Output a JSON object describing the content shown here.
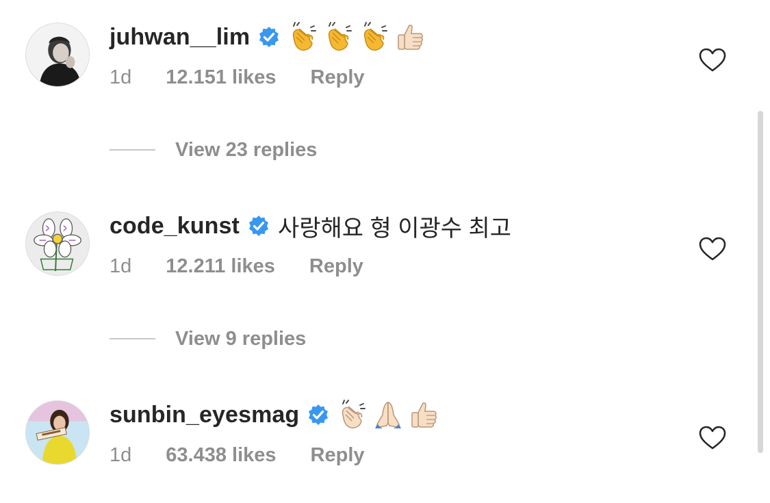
{
  "comments": [
    {
      "username": "juhwan__lim",
      "text": "",
      "emojis": [
        "clapping-hands",
        "clapping-hands",
        "clapping-hands",
        "thumbs-up"
      ],
      "time": "1d",
      "likes": "12.151 likes",
      "reply": "Reply",
      "view_replies": "View 23 replies"
    },
    {
      "username": "code_kunst",
      "text": "사랑해요 형 이광수 최고",
      "emojis": [],
      "time": "1d",
      "likes": "12.211 likes",
      "reply": "Reply",
      "view_replies": "View 9 replies"
    },
    {
      "username": "sunbin_eyesmag",
      "text": "",
      "emojis": [
        "clapping-hands",
        "folded-hands",
        "thumbs-up"
      ],
      "time": "1d",
      "likes": "63.438 likes",
      "reply": "Reply"
    }
  ],
  "colors": {
    "username": "#262626",
    "meta": "#8e8e8e",
    "verified": "#3897f0"
  }
}
